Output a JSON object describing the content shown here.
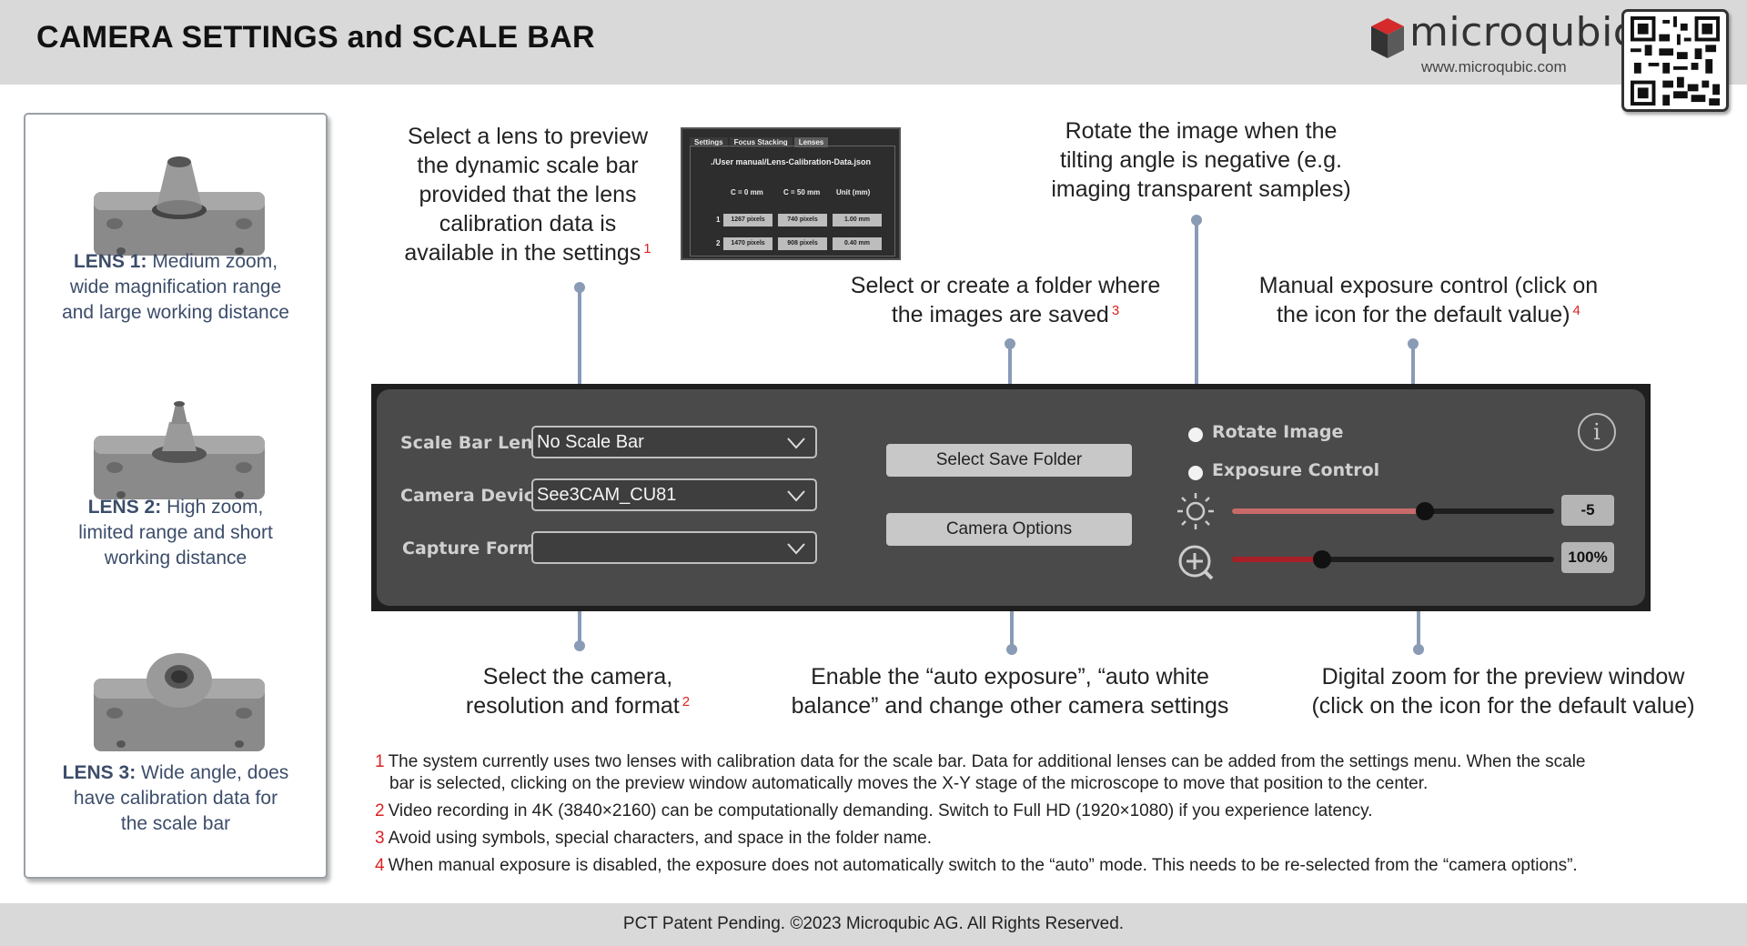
{
  "header": {
    "title": "CAMERA SETTINGS and SCALE BAR",
    "brand_name": "microqubic",
    "brand_url": "www.microqubic.com"
  },
  "lenses": [
    {
      "name": "LENS 1:",
      "desc_l1": "Medium zoom,",
      "desc_l2": "wide magnification range",
      "desc_l3": "and large working distance"
    },
    {
      "name": "LENS 2:",
      "desc_l1": "High zoom,",
      "desc_l2": "limited range and short",
      "desc_l3": "working distance"
    },
    {
      "name": "LENS 3:",
      "desc_l1": "Wide angle, does",
      "desc_l2": "have calibration data for",
      "desc_l3": "the scale bar"
    }
  ],
  "annotations": {
    "lens_preview": {
      "l1": "Select a lens to preview",
      "l2": "the dynamic scale bar",
      "l3": "provided that the lens",
      "l4": "calibration data is",
      "l5": "available in the settings",
      "ref": "1"
    },
    "rotate": {
      "l1": "Rotate the image when the",
      "l2": "tilting angle is negative (e.g.",
      "l3": "imaging transparent samples)"
    },
    "folder": {
      "l1": "Select or create a folder where",
      "l2": "the images are saved",
      "ref": "3"
    },
    "exposure": {
      "l1": "Manual exposure control (click on",
      "l2": "the icon for the default value)",
      "ref": "4"
    },
    "camera": {
      "l1": "Select the camera,",
      "l2": "resolution and format",
      "ref": "2"
    },
    "auto": {
      "l1": "Enable the “auto exposure”, “auto white",
      "l2": "balance” and change other camera settings"
    },
    "zoom": {
      "l1": "Digital zoom for the preview window",
      "l2": "(click on the icon for the default value)"
    }
  },
  "mini_screenshot": {
    "tabs": [
      "Settings",
      "Focus Stacking",
      "Lenses"
    ],
    "active_tab": "Lenses",
    "path": "./User manual/Lens-Calibration-Data.json",
    "headers": [
      "C = 0 mm",
      "C = 50 mm",
      "Unit (mm)"
    ],
    "rows": [
      {
        "index": "1",
        "c0": "1267 pixels",
        "c50": "740 pixels",
        "unit": "1.00 mm"
      },
      {
        "index": "2",
        "c0": "1470 pixels",
        "c50": "908 pixels",
        "unit": "0.40 mm"
      }
    ]
  },
  "panel": {
    "scale_bar_label": "Scale Bar Lens",
    "scale_bar_value": "No Scale Bar",
    "camera_devices_label": "Camera Devices",
    "camera_devices_value": "See3CAM_CU81",
    "capture_format_label": "Capture Format",
    "capture_format_value": "",
    "save_folder_button": "Select Save Folder",
    "camera_options_button": "Camera Options",
    "rotate_label": "Rotate Image",
    "exposure_label": "Exposure Control",
    "info_glyph": "i",
    "exposure_value": "-5",
    "exposure_slider_fraction": 0.6,
    "zoom_value": "100%",
    "zoom_slider_fraction": 0.28,
    "exposure_fill_color": "#c96a6a",
    "zoom_fill_color": "#a6202a"
  },
  "footnotes": [
    {
      "num": "1",
      "l1": "The system currently uses two lenses with calibration data for the scale bar. Data for additional lenses can be added from the settings menu. When the scale",
      "l2": "bar is selected, clicking on the preview window automatically moves the X-Y stage of the microscope to move that position to the center."
    },
    {
      "num": "2",
      "l1": "Video recording in 4K (3840×2160) can be computationally demanding. Switch to Full HD (1920×1080) if you experience latency."
    },
    {
      "num": "3",
      "l1": "Avoid using symbols, special characters, and space in the folder name."
    },
    {
      "num": "4",
      "l1": "When manual exposure is disabled, the exposure does not automatically switch to the “auto” mode. This needs to be re-selected from the “camera options”."
    }
  ],
  "footer": {
    "text": "PCT Patent Pending. ©2023 Microqubic AG. All Rights Reserved."
  },
  "icons": {
    "brand": "cube-logo-icon",
    "qr": "qr-code-icon",
    "brightness": "sun-icon",
    "zoom": "zoom-plus-icon",
    "info": "info-icon",
    "dropdown": "chevron-down-icon"
  }
}
